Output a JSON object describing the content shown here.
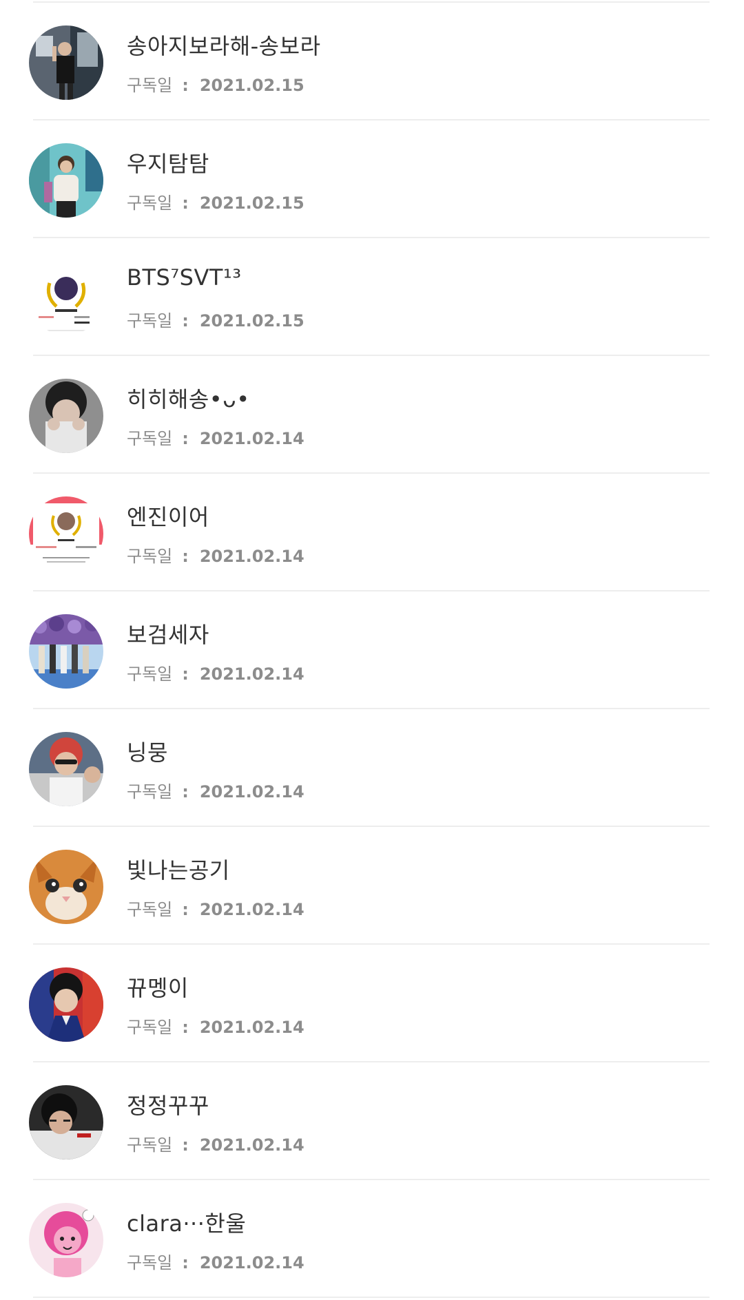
{
  "subscribers": [
    {
      "name": "송아지보라해-송보라",
      "date_label": "구독일",
      "date": "2021.02.15",
      "avatar": "photo-person-black-outfit"
    },
    {
      "name": "우지탐탐",
      "date_label": "구독일",
      "date": "2021.02.15",
      "avatar": "photo-person-white-sweater"
    },
    {
      "name": "BTS⁷SVT¹³",
      "date_label": "구독일",
      "date": "2021.02.15",
      "avatar": "badge-laurel-screenshot"
    },
    {
      "name": "히히해송•ᴗ•",
      "date_label": "구독일",
      "date": "2021.02.14",
      "avatar": "photo-person-hands-face"
    },
    {
      "name": "엔진이어",
      "date_label": "구독일",
      "date": "2021.02.14",
      "avatar": "badge-laurel-screenshot-red"
    },
    {
      "name": "보검세자",
      "date_label": "구독일",
      "date": "2021.02.14",
      "avatar": "photo-group-purple-flowers"
    },
    {
      "name": "닝뭉",
      "date_label": "구독일",
      "date": "2021.02.14",
      "avatar": "photo-person-red-hair"
    },
    {
      "name": "빛나는공기",
      "date_label": "구독일",
      "date": "2021.02.14",
      "avatar": "photo-orange-cat"
    },
    {
      "name": "뀨멩이",
      "date_label": "구독일",
      "date": "2021.02.14",
      "avatar": "photo-person-blue-jacket"
    },
    {
      "name": "정정꾸꾸",
      "date_label": "구독일",
      "date": "2021.02.14",
      "avatar": "photo-person-dark"
    },
    {
      "name": "clara···한울",
      "date_label": "구독일",
      "date": "2021.02.14",
      "avatar": "cartoon-pink-character"
    }
  ]
}
